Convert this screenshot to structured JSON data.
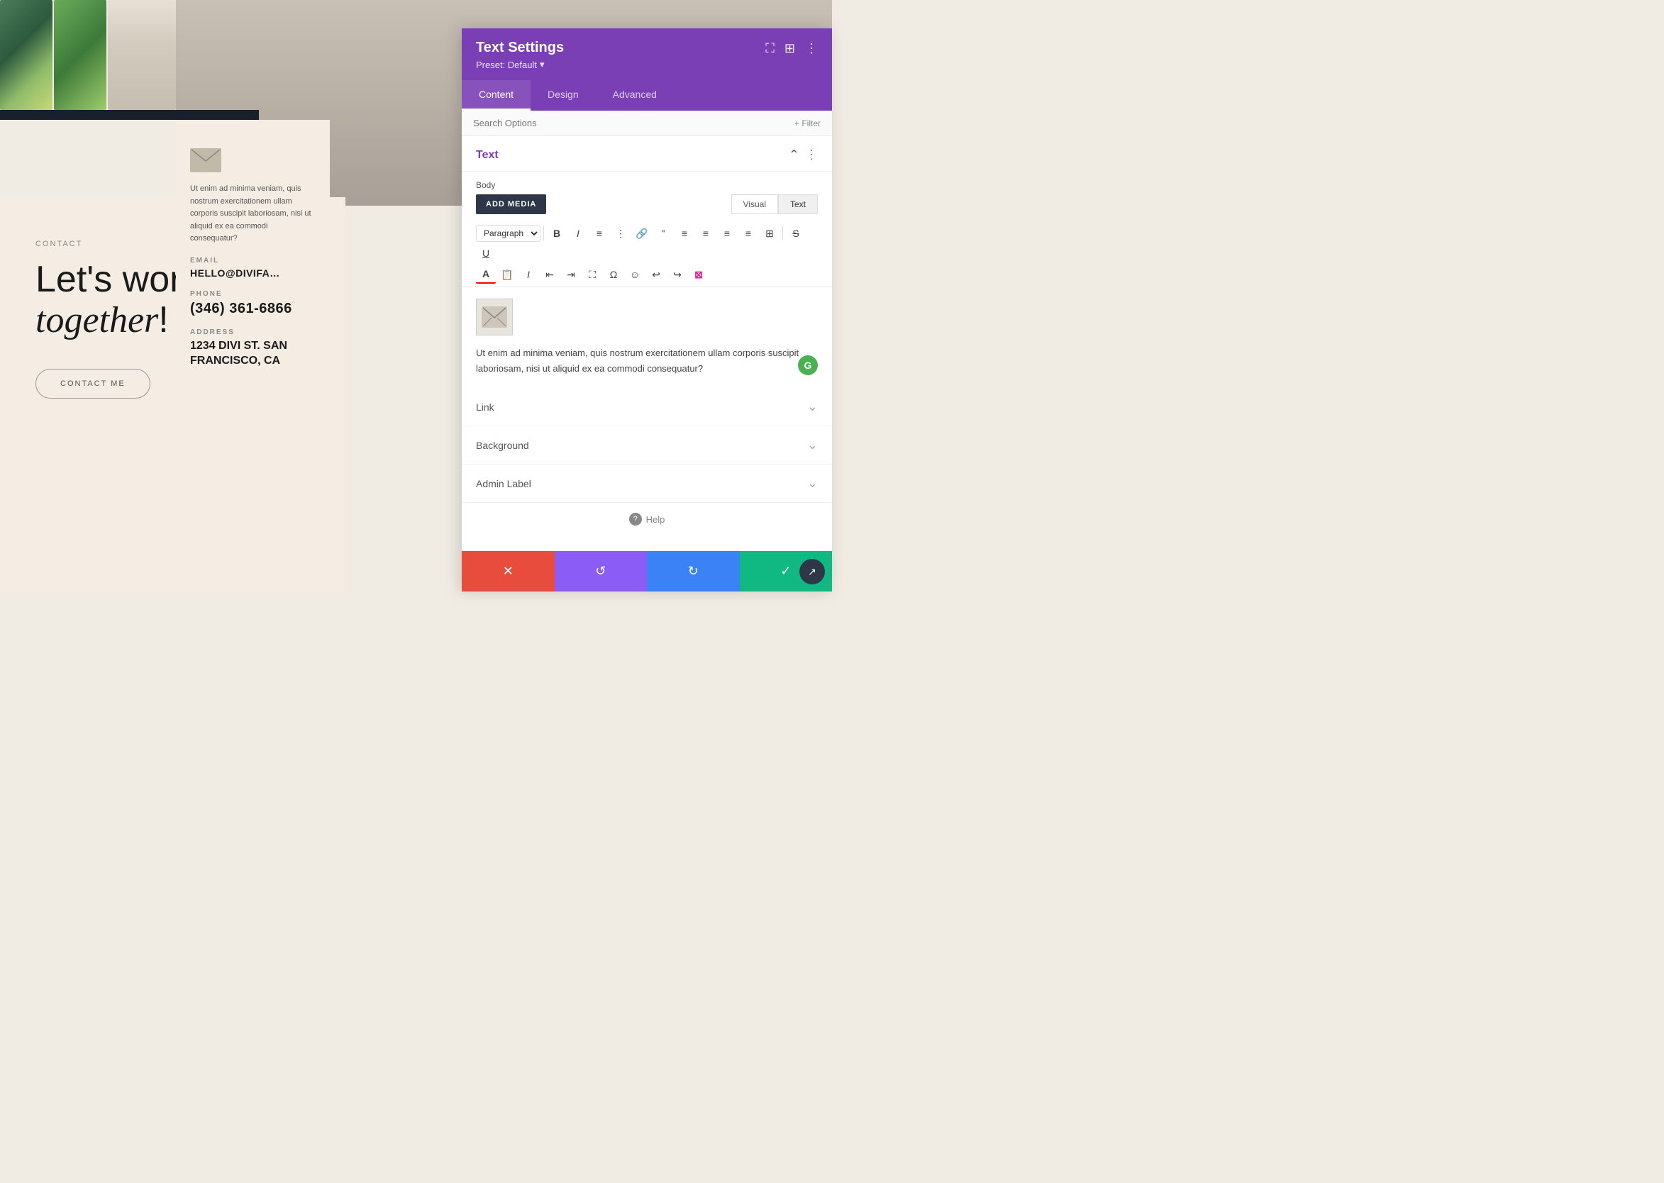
{
  "page": {
    "background_color": "#f0ebe3"
  },
  "top_images": {
    "alt_plant1": "tropical plant 1",
    "alt_plant2": "tropical plant 2",
    "alt_building": "white building",
    "alt_person": "person on stairs"
  },
  "contact_section": {
    "label": "CONTACT",
    "heading_line1": "Let's work",
    "heading_line2_italic": "together",
    "heading_line2_rest": "!",
    "button_label": "CONTACT ME",
    "body_text": "Ut enim ad minima veniam, quis nostrum exercitationem ullam corporis suscipit laboriosam, nisi ut aliquid ex ea commodi consequatur?",
    "email_label": "EMAIL",
    "email_value": "HELLO@DIVIFA…",
    "phone_label": "PHONE",
    "phone_value": "(346) 361-6866",
    "address_label": "ADDRESS",
    "address_line1": "1234 DIVI ST. SAN",
    "address_line2": "FRANCISCO, CA"
  },
  "panel": {
    "title": "Text Settings",
    "preset_label": "Preset: Default",
    "preset_arrow": "▾",
    "tabs": [
      {
        "id": "content",
        "label": "Content",
        "active": true
      },
      {
        "id": "design",
        "label": "Design",
        "active": false
      },
      {
        "id": "advanced",
        "label": "Advanced",
        "active": false
      }
    ],
    "search_placeholder": "Search Options",
    "filter_label": "+ Filter",
    "text_section": {
      "title": "Text",
      "body_label": "Body",
      "add_media_label": "ADD MEDIA",
      "visual_label": "Visual",
      "text_label": "Text",
      "paragraph_dropdown": "Paragraph",
      "editor_body_text": "Ut enim ad minima veniam, quis nostrum exercitationem ullam corporis suscipit laboriosam, nisi ut aliquid ex ea commodi consequatur?"
    },
    "collapsible_sections": [
      {
        "id": "link",
        "label": "Link"
      },
      {
        "id": "background",
        "label": "Background"
      },
      {
        "id": "admin_label",
        "label": "Admin Label"
      }
    ],
    "help_label": "Help",
    "footer": {
      "cancel_icon": "✕",
      "undo_icon": "↺",
      "redo_icon": "↻",
      "save_icon": "✓"
    }
  },
  "toolbar_icons": {
    "bold": "B",
    "italic": "I",
    "bullet_list": "≡",
    "ordered_list": "≣",
    "link": "🔗",
    "blockquote": "❝",
    "align_left": "⬛",
    "align_center": "⬛",
    "align_right": "⬛",
    "table": "⊞",
    "strikethrough": "S̶",
    "underline": "U",
    "font_color": "A",
    "copy_style": "📋",
    "italic2": "I",
    "indent_less": "⇤",
    "indent_more": "⇥",
    "fullscreen": "⛶",
    "special_char": "Ω",
    "emoji": "☺",
    "undo": "↩",
    "redo": "↪",
    "more": "⊞"
  }
}
